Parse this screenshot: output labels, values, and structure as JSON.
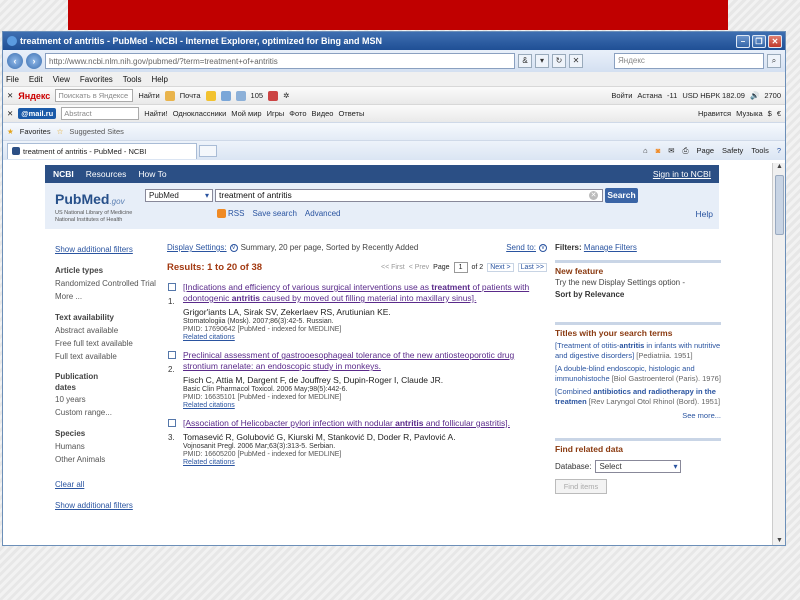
{
  "window": {
    "title": "treatment of antritis - PubMed - NCBI - Internet Explorer, optimized for Bing and MSN",
    "address": "http://www.ncbi.nlm.nih.gov/pubmed/?term=treatment+of+antritis",
    "search_placeholder": "Яндекс"
  },
  "menu": [
    "File",
    "Edit",
    "View",
    "Favorites",
    "Tools",
    "Help"
  ],
  "toolbar1": {
    "logo": "Яндекс",
    "search_placeholder": "Поискать в Яндексе",
    "find": "Найти",
    "mail": "Почта",
    "count": "105",
    "login": "Войти",
    "city": "Астана",
    "temp": "-11",
    "rate": "USD НБРК 182.09",
    "number": "2700"
  },
  "toolbar2": {
    "logo": "@mail.ru",
    "select": "Abstract",
    "find": "Найти!",
    "links": [
      "Одноклассники",
      "Мой мир",
      "Игры",
      "Фото",
      "Видео",
      "Ответы"
    ],
    "likes": "Нравится",
    "music": "Музыка"
  },
  "favbar": {
    "favorites": "Favorites",
    "suggested": "Suggested Sites"
  },
  "tab": {
    "title": "treatment of antritis - PubMed - NCBI"
  },
  "commands": [
    "Page",
    "Safety",
    "Tools"
  ],
  "ncbi": {
    "logo": "NCBI",
    "resources": "Resources",
    "howto": "How To",
    "signin": "Sign in to NCBI"
  },
  "pubmed": {
    "logo_a": "Pub",
    "logo_b": "Med",
    "logo_gov": ".gov",
    "sub1": "US National Library of Medicine",
    "sub2": "National Institutes of Health",
    "db": "PubMed",
    "term": "treatment of antritis",
    "search": "Search",
    "rss": "RSS",
    "save": "Save search",
    "advanced": "Advanced",
    "help": "Help"
  },
  "left_filters": {
    "show_top": "Show additional filters",
    "article_types": "Article types",
    "rct": "Randomized Controlled Trial",
    "more": "More ...",
    "text_avail": "Text availability",
    "abstract": "Abstract available",
    "free": "Free full text available",
    "full": "Full text available",
    "pub_dates": "Publication dates",
    "ten_years": "10 years",
    "custom": "Custom range...",
    "species": "Species",
    "humans": "Humans",
    "other": "Other Animals",
    "clear": "Clear all",
    "show_bottom": "Show additional filters"
  },
  "display": {
    "label": "Display Settings:",
    "summary": "Summary, 20 per page, Sorted by Recently Added",
    "sendto": "Send to:"
  },
  "results": {
    "count": "Results: 1 to 20 of 38",
    "first": "<< First",
    "prev": "< Prev",
    "page": "Page",
    "page_num": "1",
    "of": "of 2",
    "next": "Next >",
    "last": "Last >>"
  },
  "items": [
    {
      "num": "1.",
      "t1": "[Indications and efficiency of various surgical interventions use as ",
      "b1": "treatment",
      "t2": " of patients with odontogenic ",
      "b2": "antritis",
      "t3": " caused by moved out filling material into maxillary sinus].",
      "authors": "Grigor'iants LA, Sirak SV, Zekerlaev RS, Arutiunian KE.",
      "source": "Stomatologiia (Mosk). 2007;86(3):42-5. Russian.",
      "pmid": "PMID: 17690642 [PubMed - indexed for MEDLINE]",
      "related": "Related citations"
    },
    {
      "num": "2.",
      "t1": "Preclinical assessment of gastrooesophageal tolerance of the new antiosteoporotic drug strontium ranelate: an endoscopic study in monkeys.",
      "authors": "Fisch C, Attia M, Dargent F, de Jouffrey S, Dupin-Roger I, Claude JR.",
      "source": "Basic Clin Pharmacol Toxicol. 2006 May;98(5):442-6.",
      "pmid": "PMID: 16635101 [PubMed - indexed for MEDLINE]",
      "related": "Related citations"
    },
    {
      "num": "3.",
      "t1": "[Association of Helicobacter pylori infection with nodular ",
      "b1": "antritis",
      "t2": " and follicular gastritis].",
      "authors": "Tomasević R, Golubović G, Kiurski M, Stanković D, Doder R, Pavlović A.",
      "source": "Vojnosanit Pregl. 2006 Mar;63(3):313-5. Serbian.",
      "pmid": "PMID: 16605200 [PubMed - indexed for MEDLINE]",
      "related": "Related citations"
    }
  ],
  "right": {
    "filters_label": "Filters:",
    "manage": "Manage Filters",
    "new_feature": "New feature",
    "nf_text": "Try the new Display Settings option -",
    "nf_bold": "Sort by Relevance",
    "titles_hd": "Titles with your search terms",
    "titles": [
      {
        "a": "[Treatment of otitis-",
        "b": "antritis",
        "c": " in infants with nutritive and digestive disorders]",
        "j": " [Pediatriia. 1951]"
      },
      {
        "a": "[A double-blind endoscopic, histologic and immunohistoche",
        "b": "",
        "c": "",
        "j": " [Biol Gastroenterol (Paris). 1976]"
      },
      {
        "a": "[Combined ",
        "b": "antibiotics and radiotherapy in the treatmen",
        "c": "",
        "j": " [Rev Laryngol Otol Rhinol (Bord). 1951]"
      }
    ],
    "see_more": "See more...",
    "find_related": "Find related data",
    "database": "Database:",
    "db_value": "Select",
    "find_items": "Find items"
  },
  "colors": {
    "banner": "#c00000",
    "ncbi_bar": "#2b4f85",
    "result_count": "#a33a12",
    "link": "#2a54a0"
  }
}
